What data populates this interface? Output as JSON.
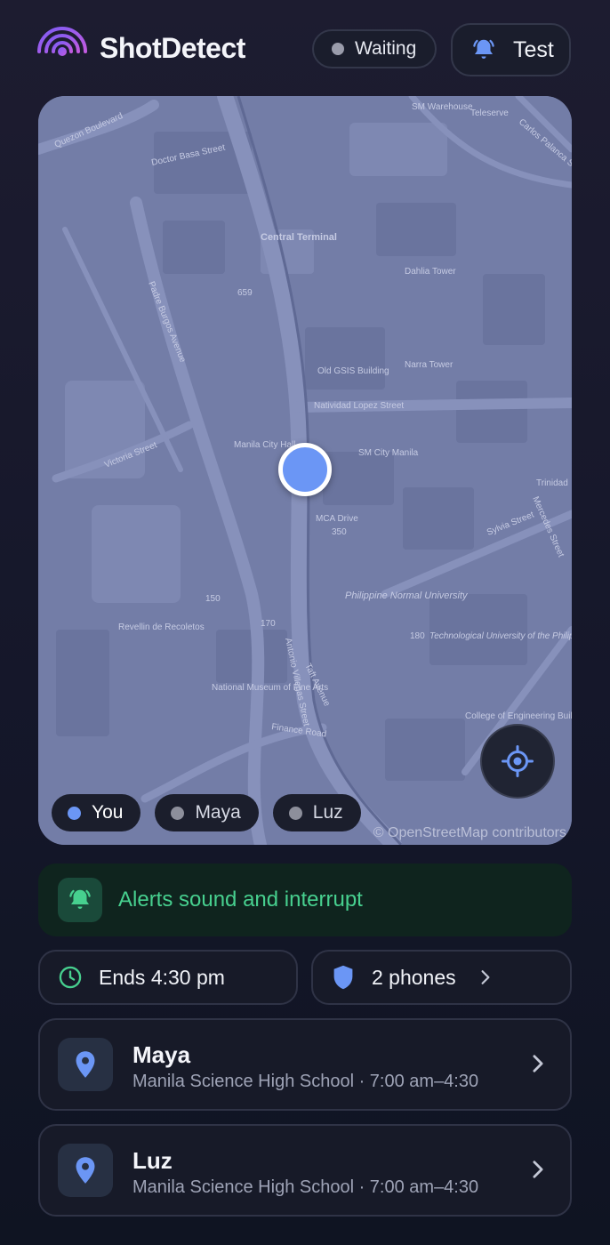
{
  "header": {
    "app_title": "ShotDetect",
    "logo_icon": "signal-waves-icon",
    "status_label": "Waiting",
    "test_label": "Test"
  },
  "map": {
    "attribution": "© OpenStreetMap contributors",
    "labels": {
      "national_museum": "National Museum of Fine Arts",
      "philippine_normal_university": "Philippine Normal University",
      "sm_city_manila": "SM City Manila",
      "manila_city_hall": "Manila City Hall",
      "central_terminal": "Central Terminal",
      "natividad_lopez_street": "Natividad Lopez Street",
      "antonio_villegas_street": "Antonio Villegas Street",
      "padre_burgos_avenue": "Padre Burgos Avenue",
      "taft_avenue": "Taft Avenue",
      "victoria_street": "Victoria Street",
      "finance_road": "Finance Road",
      "quezon_boulevard": "Quezon Boulevard",
      "mca_drive": "MCA Drive",
      "technological_university": "Technological University of the Philippines",
      "old_gsis_building": "Old GSIS Building",
      "dahlia_tower": "Dahlia Tower",
      "narra_tower": "Narra Tower",
      "revellin_de_recoletos": "Revellin de Recoletos",
      "doctor_basa_street": "Doctor Basa Street",
      "sylvia_street": "Sylvia Street",
      "mercedes_street": "Mercedes Street",
      "trinidad": "Trinidad",
      "sm_warehouse": "SM Warehouse",
      "teleserve": "Teleserve",
      "carlos_palanca_street": "Carlos Palanca Street",
      "college_of_engineering": "College of Engineering Building",
      "num_659": "659",
      "num_350": "350",
      "num_150": "150",
      "num_170": "170",
      "num_180": "180"
    },
    "chips": [
      {
        "label": "You",
        "active": true
      },
      {
        "label": "Maya",
        "active": false
      },
      {
        "label": "Luz",
        "active": false
      }
    ]
  },
  "alert_banner": {
    "text": "Alerts sound and interrupt",
    "icon": "bell-ring-icon"
  },
  "info": {
    "ends_label": "Ends 4:30 pm",
    "phones_label": "2 phones"
  },
  "people": [
    {
      "name": "Maya",
      "detail": "Manila Science High School · 7:00 am–4:30"
    },
    {
      "name": "Luz",
      "detail": "Manila Science High School · 7:00 am–4:30"
    }
  ],
  "colors": {
    "accent_blue": "#6b96f5",
    "alert_green": "#47d08f",
    "logo_purple": "#9b5ff0"
  }
}
